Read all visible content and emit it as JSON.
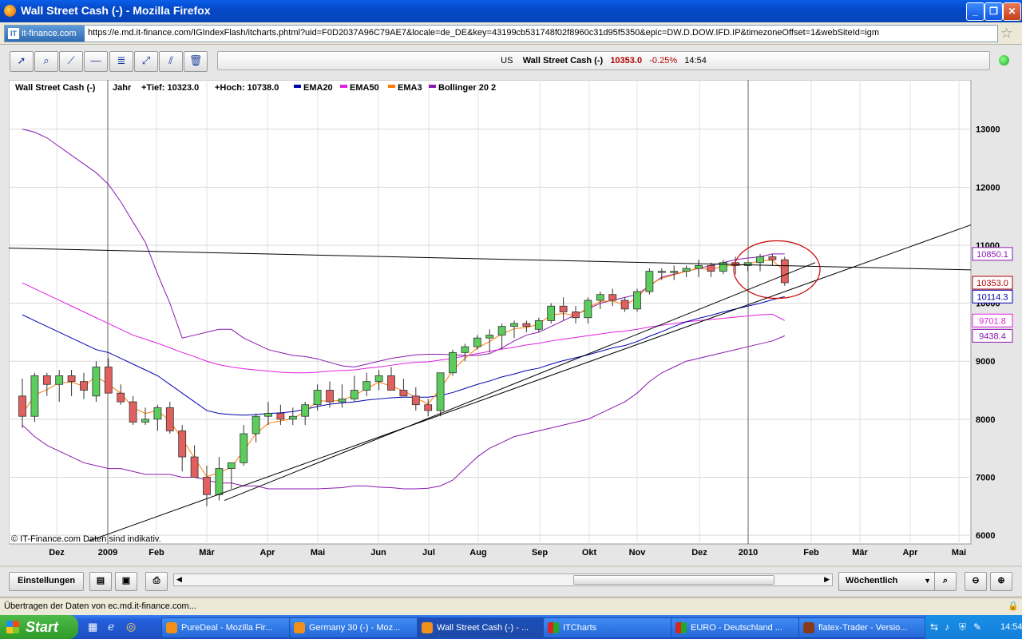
{
  "window": {
    "title": "Wall Street Cash (-) - Mozilla Firefox"
  },
  "browser": {
    "site_badge": "it-finance.com",
    "url": "https://e.md.it-finance.com/IGIndexFlash/itcharts.phtml?uid=F0D2037A96C79AE7&locale=de_DE&key=43199cb531748f02f8960c31d95f5350&epic=DW.D.DOW.IFD.IP&timezoneOffset=1&webSiteId=igm"
  },
  "infobar": {
    "region": "US",
    "name": "Wall Street Cash (-)",
    "price": "10353.0",
    "change": "-0.25%",
    "time": "14:54"
  },
  "legend": {
    "name": "Wall Street Cash (-)",
    "period": "Jahr",
    "low": "+Tief: 10323.0",
    "high": "+Hoch: 10738.0",
    "series": [
      {
        "label": "EMA20",
        "color": "#0000b0"
      },
      {
        "label": "EMA50",
        "color": "#e020e0"
      },
      {
        "label": "EMA3",
        "color": "#ff7a00"
      },
      {
        "label": "Bollinger 20 2",
        "color": "#8a1ab0"
      }
    ]
  },
  "copyright": "© IT-Finance.com Daten sind indikativ.",
  "chart_data": {
    "type": "candlestick",
    "yaxis": {
      "ticks": [
        6000,
        7000,
        8000,
        9000,
        10000,
        11000,
        12000,
        13000
      ],
      "range": [
        5850,
        13850
      ]
    },
    "xaxis": {
      "labels": [
        "Dez",
        "2009",
        "Feb",
        "Mär",
        "Apr",
        "Mai",
        "Jun",
        "Jul",
        "Aug",
        "Sep",
        "Okt",
        "Nov",
        "Dez",
        "2010",
        "Feb",
        "Mär",
        "Apr",
        "Mai"
      ]
    },
    "value_labels": [
      {
        "text": "10850.1",
        "value": 10850.1,
        "color": "#8a1ab0"
      },
      {
        "text": "10353.0",
        "value": 10353,
        "color": "#b00000"
      },
      {
        "text": "10114.3",
        "value": 10114.3,
        "color": "#0000b0"
      },
      {
        "text": "9701.8",
        "value": 9701.8,
        "color": "#e020e0"
      },
      {
        "text": "9438.4",
        "value": 9438.4,
        "color": "#8a1ab0"
      }
    ],
    "candles": [
      [
        8400,
        8700,
        7850,
        8050
      ],
      [
        8050,
        8800,
        7950,
        8750
      ],
      [
        8750,
        8800,
        8400,
        8600
      ],
      [
        8600,
        8850,
        8300,
        8750
      ],
      [
        8750,
        8850,
        8400,
        8650
      ],
      [
        8650,
        8800,
        8350,
        8500
      ],
      [
        8400,
        9000,
        8300,
        8900
      ],
      [
        8900,
        9050,
        8450,
        8450
      ],
      [
        8450,
        8600,
        8250,
        8300
      ],
      [
        8300,
        8400,
        7900,
        7950
      ],
      [
        7950,
        8200,
        7900,
        8000
      ],
      [
        8000,
        8250,
        7800,
        8200
      ],
      [
        8200,
        8300,
        7750,
        7800
      ],
      [
        7800,
        7900,
        7100,
        7350
      ],
      [
        7350,
        7550,
        7000,
        7000
      ],
      [
        7000,
        7200,
        6500,
        6700
      ],
      [
        6700,
        7350,
        6600,
        7150
      ],
      [
        7150,
        7250,
        6800,
        7250
      ],
      [
        7250,
        7900,
        7200,
        7750
      ],
      [
        7750,
        8100,
        7600,
        8050
      ],
      [
        8050,
        8300,
        7900,
        8100
      ],
      [
        8100,
        8250,
        7900,
        8000
      ],
      [
        8000,
        8200,
        7900,
        8050
      ],
      [
        8050,
        8300,
        7900,
        8250
      ],
      [
        8250,
        8600,
        8150,
        8500
      ],
      [
        8500,
        8650,
        8200,
        8300
      ],
      [
        8300,
        8600,
        8200,
        8350
      ],
      [
        8350,
        8750,
        8300,
        8500
      ],
      [
        8500,
        8800,
        8400,
        8650
      ],
      [
        8650,
        8850,
        8500,
        8750
      ],
      [
        8750,
        8900,
        8500,
        8500
      ],
      [
        8500,
        8700,
        8400,
        8400
      ],
      [
        8400,
        8550,
        8150,
        8250
      ],
      [
        8250,
        8350,
        8050,
        8150
      ],
      [
        8150,
        8800,
        8050,
        8800
      ],
      [
        8800,
        9200,
        8750,
        9150
      ],
      [
        9150,
        9300,
        9000,
        9250
      ],
      [
        9250,
        9450,
        9200,
        9400
      ],
      [
        9400,
        9550,
        9150,
        9450
      ],
      [
        9450,
        9650,
        9200,
        9600
      ],
      [
        9600,
        9700,
        9400,
        9650
      ],
      [
        9650,
        9700,
        9500,
        9600
      ],
      [
        9550,
        9750,
        9500,
        9700
      ],
      [
        9700,
        10000,
        9650,
        9950
      ],
      [
        9950,
        10100,
        9700,
        9850
      ],
      [
        9850,
        9950,
        9650,
        9750
      ],
      [
        9750,
        10100,
        9650,
        10050
      ],
      [
        10050,
        10200,
        9900,
        10150
      ],
      [
        10150,
        10250,
        9950,
        10050
      ],
      [
        10050,
        10100,
        9850,
        9900
      ],
      [
        9900,
        10250,
        9850,
        10200
      ],
      [
        10200,
        10600,
        10150,
        10550
      ],
      [
        10550,
        10600,
        10400,
        10550
      ],
      [
        10550,
        10650,
        10400,
        10550
      ],
      [
        10550,
        10650,
        10450,
        10600
      ],
      [
        10600,
        10750,
        10450,
        10650
      ],
      [
        10650,
        10700,
        10450,
        10550
      ],
      [
        10550,
        10750,
        10500,
        10700
      ],
      [
        10700,
        10800,
        10500,
        10650
      ],
      [
        10650,
        10700,
        10550,
        10700
      ],
      [
        10700,
        10850,
        10550,
        10800
      ],
      [
        10800,
        10850,
        10650,
        10750
      ],
      [
        10750,
        10800,
        10300,
        10353
      ]
    ],
    "ema3": [
      8080,
      8420,
      8510,
      8630,
      8640,
      8570,
      8740,
      8600,
      8450,
      8200,
      8100,
      8150,
      7970,
      7660,
      7330,
      7010,
      7080,
      7170,
      7460,
      7750,
      7930,
      7970,
      8010,
      8130,
      8320,
      8310,
      8330,
      8410,
      8530,
      8640,
      8570,
      8490,
      8370,
      8260,
      8530,
      8840,
      9050,
      9230,
      9340,
      9470,
      9560,
      9580,
      9640,
      9800,
      9820,
      9790,
      9920,
      10030,
      10040,
      9970,
      10090,
      10320,
      10430,
      10490,
      10550,
      10600,
      10580,
      10640,
      10650,
      10670,
      10740,
      10740,
      10550
    ],
    "ema20": [
      9800,
      9700,
      9600,
      9500,
      9400,
      9300,
      9200,
      9150,
      9050,
      8950,
      8850,
      8750,
      8600,
      8450,
      8300,
      8150,
      8100,
      8080,
      8070,
      8080,
      8100,
      8110,
      8130,
      8170,
      8220,
      8260,
      8280,
      8300,
      8330,
      8350,
      8370,
      8380,
      8380,
      8380,
      8410,
      8460,
      8530,
      8600,
      8660,
      8730,
      8780,
      8840,
      8880,
      8950,
      9010,
      9060,
      9110,
      9170,
      9230,
      9270,
      9340,
      9430,
      9510,
      9600,
      9680,
      9740,
      9790,
      9850,
      9900,
      9950,
      10000,
      10060,
      10114
    ],
    "ema50": [
      10350,
      10250,
      10150,
      10050,
      9950,
      9850,
      9750,
      9650,
      9550,
      9450,
      9380,
      9310,
      9230,
      9150,
      9080,
      9000,
      8940,
      8900,
      8870,
      8850,
      8830,
      8810,
      8800,
      8800,
      8810,
      8830,
      8840,
      8850,
      8880,
      8900,
      8930,
      8960,
      8980,
      8990,
      9020,
      9050,
      9090,
      9130,
      9170,
      9210,
      9240,
      9280,
      9310,
      9350,
      9380,
      9410,
      9440,
      9470,
      9500,
      9520,
      9550,
      9590,
      9620,
      9650,
      9680,
      9700,
      9720,
      9740,
      9760,
      9780,
      9800,
      9810,
      9701.8
    ],
    "bb_upper": [
      13000,
      12950,
      12850,
      12700,
      12550,
      12400,
      12250,
      12050,
      11750,
      11400,
      11050,
      10500,
      10000,
      9400,
      9450,
      9500,
      9550,
      9550,
      9400,
      9300,
      9200,
      9150,
      9100,
      9080,
      9040,
      8980,
      8920,
      8900,
      8950,
      9000,
      9050,
      9080,
      9110,
      9120,
      9120,
      9110,
      9100,
      9100,
      9130,
      9230,
      9350,
      9450,
      9500,
      9600,
      9700,
      9800,
      9900,
      10000,
      10050,
      10100,
      10150,
      10300,
      10450,
      10500,
      10550,
      10600,
      10650,
      10700,
      10750,
      10780,
      10800,
      10850,
      10850.1
    ],
    "bb_lower": [
      7900,
      7700,
      7550,
      7450,
      7350,
      7250,
      7200,
      7150,
      7150,
      7100,
      7050,
      7050,
      7050,
      7000,
      7000,
      6950,
      6900,
      6900,
      6850,
      6850,
      6800,
      6800,
      6800,
      6800,
      6800,
      6810,
      6820,
      6850,
      6850,
      6830,
      6820,
      6800,
      6800,
      6810,
      6850,
      6950,
      7150,
      7350,
      7500,
      7600,
      7700,
      7750,
      7800,
      7850,
      7900,
      7950,
      8000,
      8100,
      8200,
      8300,
      8450,
      8650,
      8800,
      8900,
      9000,
      9050,
      9100,
      9150,
      9200,
      9250,
      9300,
      9350,
      9438.4
    ]
  },
  "bottom": {
    "settings": "Einstellungen",
    "interval": "Wöchentlich"
  },
  "status": "Übertragen der Daten von ec.md.it-finance.com...",
  "taskbar": {
    "start": "Start",
    "tasks": [
      {
        "label": "PureDeal - Mozilla Fir...",
        "icon": "firefox-icon"
      },
      {
        "label": "Germany 30 (-) - Moz...",
        "icon": "firefox-icon"
      },
      {
        "label": "Wall Street Cash (-) - ...",
        "icon": "firefox-icon"
      },
      {
        "label": "ITCharts",
        "icon": "chart-icon"
      },
      {
        "label": "EURO - Deutschland ...",
        "icon": "chart-icon"
      },
      {
        "label": "flatex-Trader - Versio...",
        "icon": "app-icon"
      }
    ],
    "clock": "14:54"
  }
}
